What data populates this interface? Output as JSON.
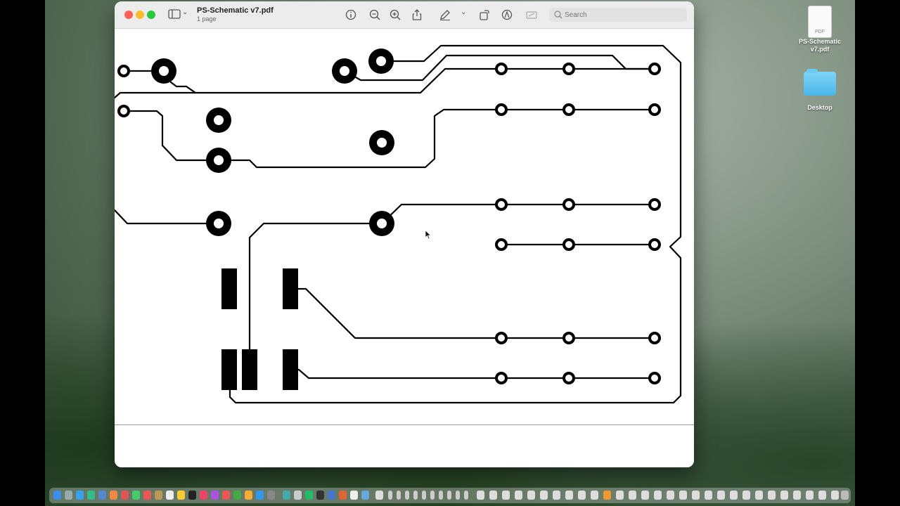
{
  "window": {
    "title": "PS-Schematic v7.pdf",
    "subtitle": "1 page"
  },
  "toolbar": {
    "icons": [
      "sidebar-toggle-icon",
      "chevron-down-icon",
      "info-icon",
      "zoom-out-icon",
      "zoom-in-icon",
      "share-icon",
      "markup-pen-icon",
      "chevron-down-icon",
      "rotate-icon",
      "annotate-icon",
      "signature-icon"
    ],
    "search_placeholder": "Search"
  },
  "desktop": {
    "items": [
      {
        "label": "PS-Schematic v7.pdf",
        "kind": "pdf-file",
        "thumb_text": "PDF"
      },
      {
        "label": "Desktop",
        "kind": "folder"
      }
    ]
  },
  "colors": {
    "trace": "#000000",
    "page": "#ffffff",
    "titlebar": "#ececec",
    "close": "#ff5f57",
    "minimize": "#febc2e",
    "maximize": "#28c840",
    "folder": "#4ab6ea"
  }
}
